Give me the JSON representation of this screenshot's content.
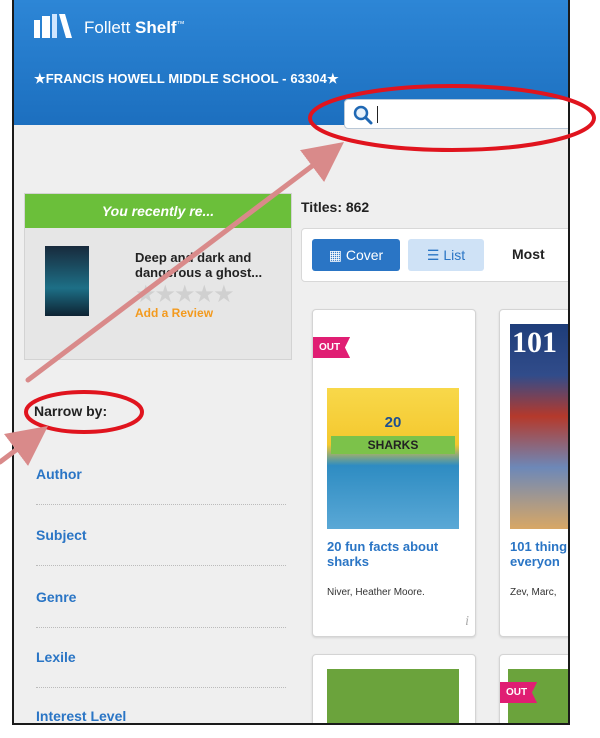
{
  "header": {
    "brand_prefix": "Follett ",
    "brand_bold": "Shelf",
    "brand_tm": "™",
    "school": "★FRANCIS HOWELL MIDDLE SCHOOL - 63304★",
    "search_value": ""
  },
  "recent": {
    "heading": "You recently re...",
    "book_title": "Deep and dark and dangerous a ghost...",
    "stars": "★★★★★",
    "add_review": "Add a Review"
  },
  "narrow": {
    "label": "Narrow by:",
    "facets": [
      "Author",
      "Subject",
      "Genre",
      "Lexile",
      "Interest Level"
    ]
  },
  "results": {
    "titles_label": "Titles: 862",
    "cover_button": "Cover",
    "list_button": "List",
    "sort_label": "Most"
  },
  "cards": [
    {
      "badge": "OUT",
      "cover_top": "20",
      "cover_banner": "SHARKS",
      "title": "20 fun facts about sharks",
      "author": "Niver, Heather Moore."
    },
    {
      "badge": "",
      "cover_top": "101",
      "title": "101 thing everyon",
      "author": "Zev, Marc,"
    },
    {
      "badge": ""
    },
    {
      "badge": "OUT"
    }
  ],
  "colors": {
    "header_blue": "#1c6fbf",
    "recent_green": "#6bbf3a",
    "link_blue": "#2a75c5",
    "ribbon_pink": "#e01e73",
    "annotation_red": "#e0141e",
    "arrow_pink": "#d98a8a"
  }
}
